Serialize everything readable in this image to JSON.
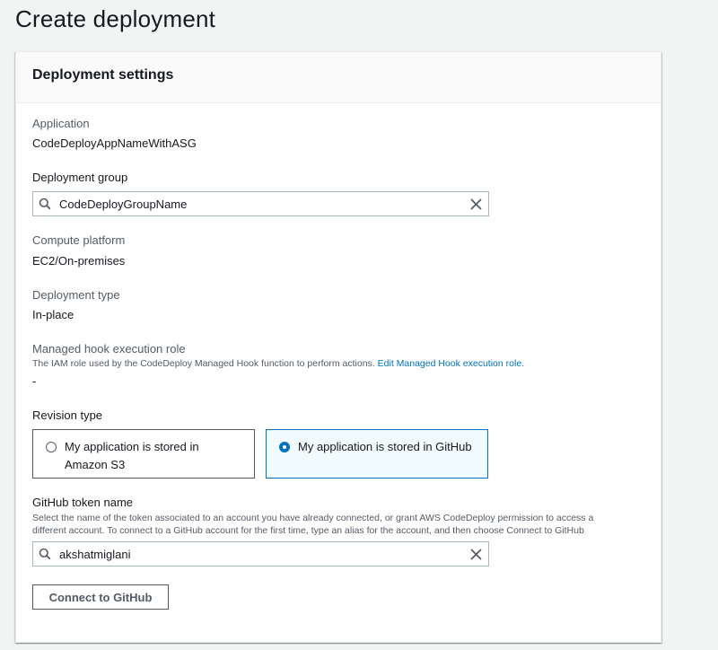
{
  "page": {
    "title": "Create deployment"
  },
  "panel": {
    "title": "Deployment settings"
  },
  "application": {
    "label": "Application",
    "value": "CodeDeployAppNameWithASG"
  },
  "deployment_group": {
    "label": "Deployment group",
    "value": "CodeDeployGroupName",
    "icons": {
      "left": "search-icon",
      "right": "clear-icon"
    }
  },
  "compute_platform": {
    "label": "Compute platform",
    "value": "EC2/On-premises"
  },
  "deployment_type": {
    "label": "Deployment type",
    "value": "In-place"
  },
  "managed_hook": {
    "label": "Managed hook execution role",
    "description": "The IAM role used by the CodeDeploy Managed Hook function to perform actions.",
    "link": "Edit Managed Hook execution role.",
    "value": "-"
  },
  "revision_type": {
    "label": "Revision type",
    "options": [
      {
        "label": "My application is stored in Amazon S3",
        "selected": false
      },
      {
        "label": "My application is stored in GitHub",
        "selected": true
      }
    ]
  },
  "github_token": {
    "label": "GitHub token name",
    "description": "Select the name of the token associated to an account you have already connected, or grant AWS CodeDeploy permission to access a different account. To connect to a GitHub account for the first time, type an alias for the account, and then choose Connect to GitHub",
    "value": "akshatmiglani",
    "icons": {
      "left": "search-icon",
      "right": "clear-icon"
    }
  },
  "connect_button": {
    "label": "Connect to GitHub"
  },
  "colors": {
    "background": "#f2f3f3",
    "text": "#16191f",
    "secondary_text": "#545b64",
    "link": "#0073bb",
    "selected_bg": "#f1faff"
  }
}
